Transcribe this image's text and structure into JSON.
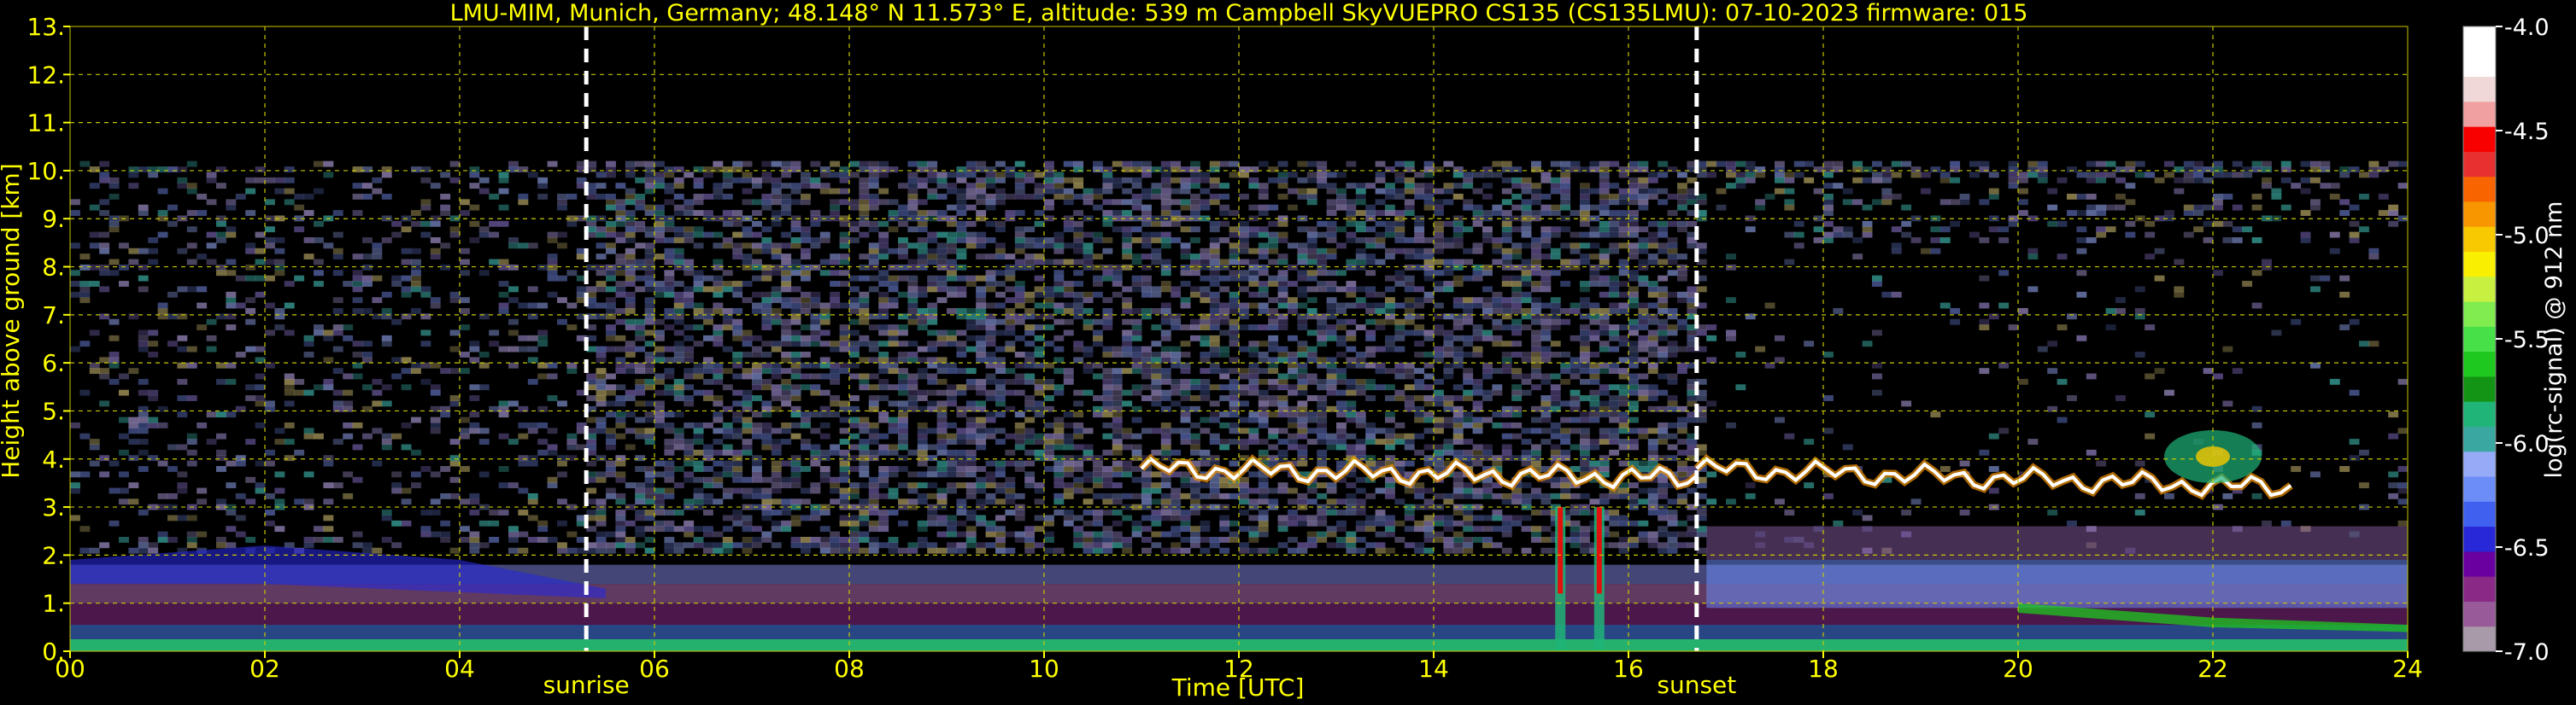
{
  "title": "LMU-MIM, Munich, Germany; 48.148° N 11.573° E, altitude: 539 m    Campbell SkyVUEPRO CS135 (CS135LMU): 07-10-2023    firmware: 015",
  "colors": {
    "background": "#000000",
    "text": "#ffff00",
    "grid": "#c8c800",
    "marker": "#ffffff",
    "colorbar_text": "#ffffff"
  },
  "chart_data": {
    "type": "heatmap",
    "xlabel": "Time [UTC]",
    "ylabel": "Height above ground [km]",
    "xlim": [
      0,
      24
    ],
    "ylim": [
      0,
      13
    ],
    "x_ticks": [
      {
        "v": 0,
        "label": "00"
      },
      {
        "v": 2,
        "label": "02"
      },
      {
        "v": 4,
        "label": "04"
      },
      {
        "v": 6,
        "label": "06"
      },
      {
        "v": 8,
        "label": "08"
      },
      {
        "v": 10,
        "label": "10"
      },
      {
        "v": 12,
        "label": "12"
      },
      {
        "v": 14,
        "label": "14"
      },
      {
        "v": 16,
        "label": "16"
      },
      {
        "v": 18,
        "label": "18"
      },
      {
        "v": 20,
        "label": "20"
      },
      {
        "v": 22,
        "label": "22"
      },
      {
        "v": 24,
        "label": "24"
      }
    ],
    "y_ticks": [
      {
        "v": 0,
        "label": "0."
      },
      {
        "v": 1,
        "label": "1."
      },
      {
        "v": 2,
        "label": "2."
      },
      {
        "v": 3,
        "label": "3."
      },
      {
        "v": 4,
        "label": "4."
      },
      {
        "v": 5,
        "label": "5."
      },
      {
        "v": 6,
        "label": "6."
      },
      {
        "v": 7,
        "label": "7."
      },
      {
        "v": 8,
        "label": "8."
      },
      {
        "v": 9,
        "label": "9."
      },
      {
        "v": 10,
        "label": "10."
      },
      {
        "v": 11,
        "label": "11."
      },
      {
        "v": 12,
        "label": "12."
      },
      {
        "v": 13,
        "label": "13."
      }
    ],
    "grid": true,
    "markers": [
      {
        "label": "sunrise",
        "time": 5.3
      },
      {
        "label": "sunset",
        "time": 16.7
      }
    ],
    "signal_top_km": 10.2,
    "features": [
      {
        "kind": "cloud-layer",
        "time_start": 11.0,
        "time_end": 16.7,
        "height_start_km": 3.8,
        "height_end_km": 3.6,
        "note": "bright white/orange cloud base"
      },
      {
        "kind": "cloud-layer",
        "time_start": 16.7,
        "time_end": 22.8,
        "height_start_km": 3.8,
        "height_end_km": 3.4
      },
      {
        "kind": "cloud-patch",
        "time_start": 21.5,
        "time_end": 22.5,
        "height_start_km": 3.5,
        "height_end_km": 4.6
      },
      {
        "kind": "precipitation-streak",
        "time": 15.3,
        "height_km": 3.0
      },
      {
        "kind": "precipitation-streak",
        "time": 15.7,
        "height_km": 3.0
      },
      {
        "kind": "aerosol-layer",
        "time_start": 0,
        "time_end": 24,
        "height_start_km": 0,
        "height_end_km": 1.8
      }
    ],
    "colorbar": {
      "label": "log(rc-signal) @ 912 nm",
      "range": [
        -7.0,
        -4.0
      ],
      "ticks": [
        {
          "v": -4.0,
          "label": "-4.0"
        },
        {
          "v": -4.5,
          "label": "-4.5"
        },
        {
          "v": -5.0,
          "label": "-5.0"
        },
        {
          "v": -5.5,
          "label": "-5.5"
        },
        {
          "v": -6.0,
          "label": "-6.0"
        },
        {
          "v": -6.5,
          "label": "-6.5"
        },
        {
          "v": -7.0,
          "label": "-7.0"
        }
      ],
      "colors": [
        "#a89aa8",
        "#985a98",
        "#8a2a86",
        "#6a00a0",
        "#2828d8",
        "#4060f0",
        "#6c8cf8",
        "#96aaf8",
        "#3aa8a0",
        "#20b478",
        "#149414",
        "#1ec81e",
        "#48e048",
        "#80ec50",
        "#c8f040",
        "#f8f000",
        "#f8c800",
        "#f89600",
        "#f86400",
        "#e83030",
        "#f80000",
        "#f0a0a0",
        "#f0d8d8",
        "#ffffff",
        "#ffffff"
      ]
    }
  }
}
